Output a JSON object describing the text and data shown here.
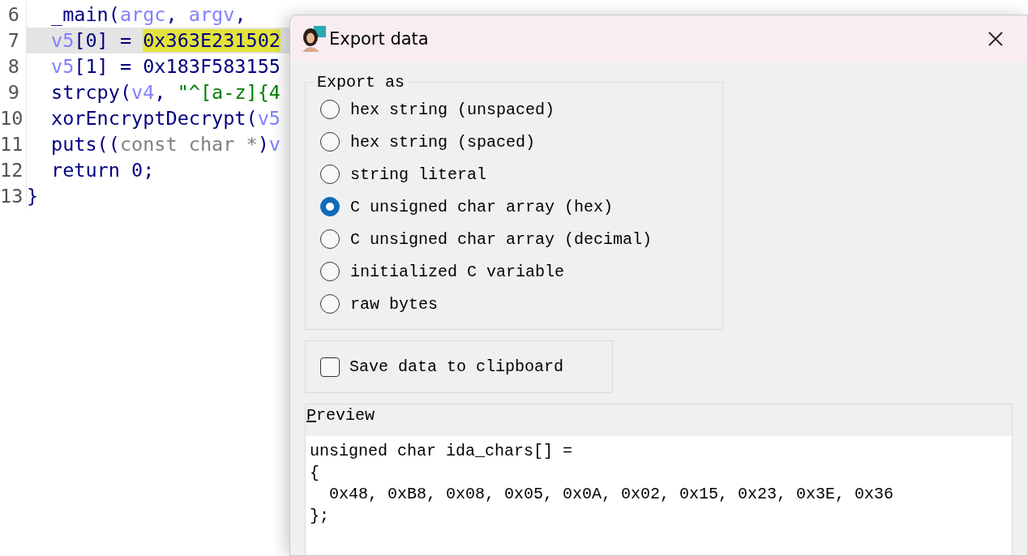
{
  "code": {
    "lines": [
      {
        "number": "6",
        "highlighted": false,
        "tokens": [
          {
            "kind": "fn",
            "text": "_main("
          },
          {
            "kind": "var",
            "text": "argc"
          },
          {
            "kind": "plain",
            "text": ", "
          },
          {
            "kind": "var",
            "text": "argv"
          },
          {
            "kind": "plain",
            "text": ", "
          }
        ]
      },
      {
        "number": "7",
        "highlighted": true,
        "tokens": [
          {
            "kind": "var",
            "text": "v5"
          },
          {
            "kind": "plain",
            "text": "[0] = "
          },
          {
            "kind": "mark",
            "text": "0x363E231502"
          }
        ]
      },
      {
        "number": "8",
        "highlighted": false,
        "tokens": [
          {
            "kind": "var",
            "text": "v5"
          },
          {
            "kind": "plain",
            "text": "[1] = 0x183F583155"
          }
        ]
      },
      {
        "number": "9",
        "highlighted": false,
        "tokens": [
          {
            "kind": "fn",
            "text": "strcpy("
          },
          {
            "kind": "var",
            "text": "v4"
          },
          {
            "kind": "plain",
            "text": ", "
          },
          {
            "kind": "str",
            "text": "\"^[a-z]{4"
          }
        ]
      },
      {
        "number": "10",
        "highlighted": false,
        "tokens": [
          {
            "kind": "fn",
            "text": "xorEncryptDecrypt("
          },
          {
            "kind": "var",
            "text": "v5"
          }
        ]
      },
      {
        "number": "11",
        "highlighted": false,
        "tokens": [
          {
            "kind": "fn",
            "text": "puts(("
          },
          {
            "kind": "type",
            "text": "const char *"
          },
          {
            "kind": "fn",
            "text": ")"
          },
          {
            "kind": "var",
            "text": "v"
          }
        ]
      },
      {
        "number": "12",
        "highlighted": false,
        "tokens": [
          {
            "kind": "plain",
            "text": "return 0;"
          }
        ]
      },
      {
        "number": "13",
        "highlighted": false,
        "tokens": [
          {
            "kind": "brace",
            "text": "}"
          }
        ]
      }
    ]
  },
  "dialog": {
    "title": "Export data",
    "export_as": {
      "label": "Export as",
      "options": [
        {
          "label": "hex string (unspaced)",
          "selected": false
        },
        {
          "label": "hex string (spaced)",
          "selected": false
        },
        {
          "label": "string literal",
          "selected": false
        },
        {
          "label": "C unsigned char array (hex)",
          "selected": true
        },
        {
          "label": "C unsigned char array (decimal)",
          "selected": false
        },
        {
          "label": "initialized C variable",
          "selected": false
        },
        {
          "label": "raw bytes",
          "selected": false
        }
      ]
    },
    "save_to_clipboard": {
      "label": "Save data to clipboard",
      "checked": false
    },
    "preview": {
      "label": "Preview",
      "lines": [
        "unsigned char ida_chars[] =",
        "{",
        "  0x48, 0xB8, 0x08, 0x05, 0x0A, 0x02, 0x15, 0x23, 0x3E, 0x36",
        "};"
      ]
    }
  }
}
